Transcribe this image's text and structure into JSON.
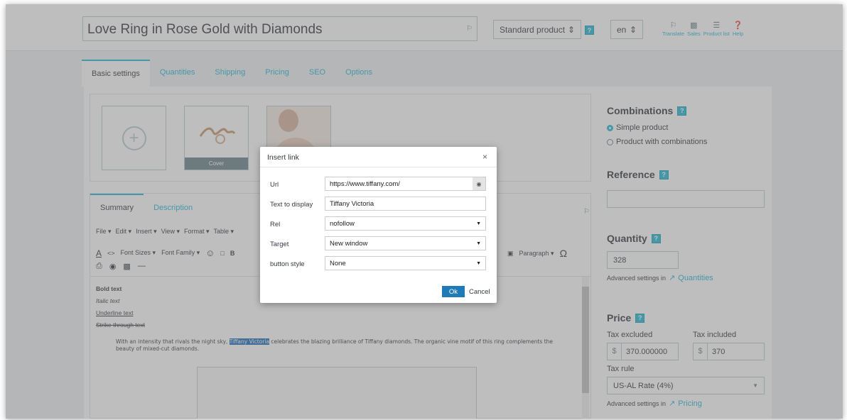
{
  "header": {
    "product_name": "Love Ring in Rose Gold with Diamonds",
    "product_type": "Standard product",
    "language": "en",
    "toolbar": [
      {
        "label": "Translate",
        "icon": "translate-icon"
      },
      {
        "label": "Sales",
        "icon": "sales-icon"
      },
      {
        "label": "Product list",
        "icon": "list-icon"
      },
      {
        "label": "Help",
        "icon": "help-icon"
      }
    ]
  },
  "tabs": [
    "Basic settings",
    "Quantities",
    "Shipping",
    "Pricing",
    "SEO",
    "Options"
  ],
  "images": {
    "cover_label": "Cover"
  },
  "editor": {
    "tabs": [
      "Summary",
      "Description"
    ],
    "menu": [
      "File ▾",
      "Edit ▾",
      "Insert ▾",
      "View ▾",
      "Format ▾",
      "Table ▾"
    ],
    "font_sizes": "Font Sizes ▾",
    "font_family": "Font Family ▾",
    "paragraph": "Paragraph ▾",
    "bold_text": "Bold text",
    "italic_text": "Italic text",
    "underline_text": "Underline text",
    "strike_text": "Strike through text",
    "body_before": "With an intensity that rivals the night sky, ",
    "body_highlight": "Tiffany Victoria",
    "body_after": " celebrates the blazing brilliance of Tiffany diamonds. The organic vine motif of this ring complements the beauty of mixed-cut diamonds."
  },
  "sidebar": {
    "combinations_title": "Combinations",
    "simple_product": "Simple product",
    "product_with_combinations": "Product with combinations",
    "reference_title": "Reference",
    "reference_value": "",
    "quantity_title": "Quantity",
    "quantity_value": "328",
    "advanced_settings_in": "Advanced settings in",
    "quantities_link": "Quantities",
    "price_title": "Price",
    "tax_excluded_label": "Tax excluded",
    "tax_included_label": "Tax included",
    "currency": "$",
    "price_excl": "370.000000",
    "price_incl": "370",
    "tax_rule_label": "Tax rule",
    "tax_rule_value": "US-AL Rate (4%)",
    "pricing_link": "Pricing"
  },
  "dialog": {
    "title": "Insert link",
    "close": "×",
    "url_label": "Url",
    "url_value": "https://www.tiffany.com/",
    "text_label": "Text to display",
    "text_value": "Tiffany Victoria",
    "rel_label": "Rel",
    "rel_value": "nofollow",
    "target_label": "Target",
    "target_value": "New window",
    "style_label": "button style",
    "style_value": "None",
    "ok": "Ok",
    "cancel": "Cancel"
  }
}
